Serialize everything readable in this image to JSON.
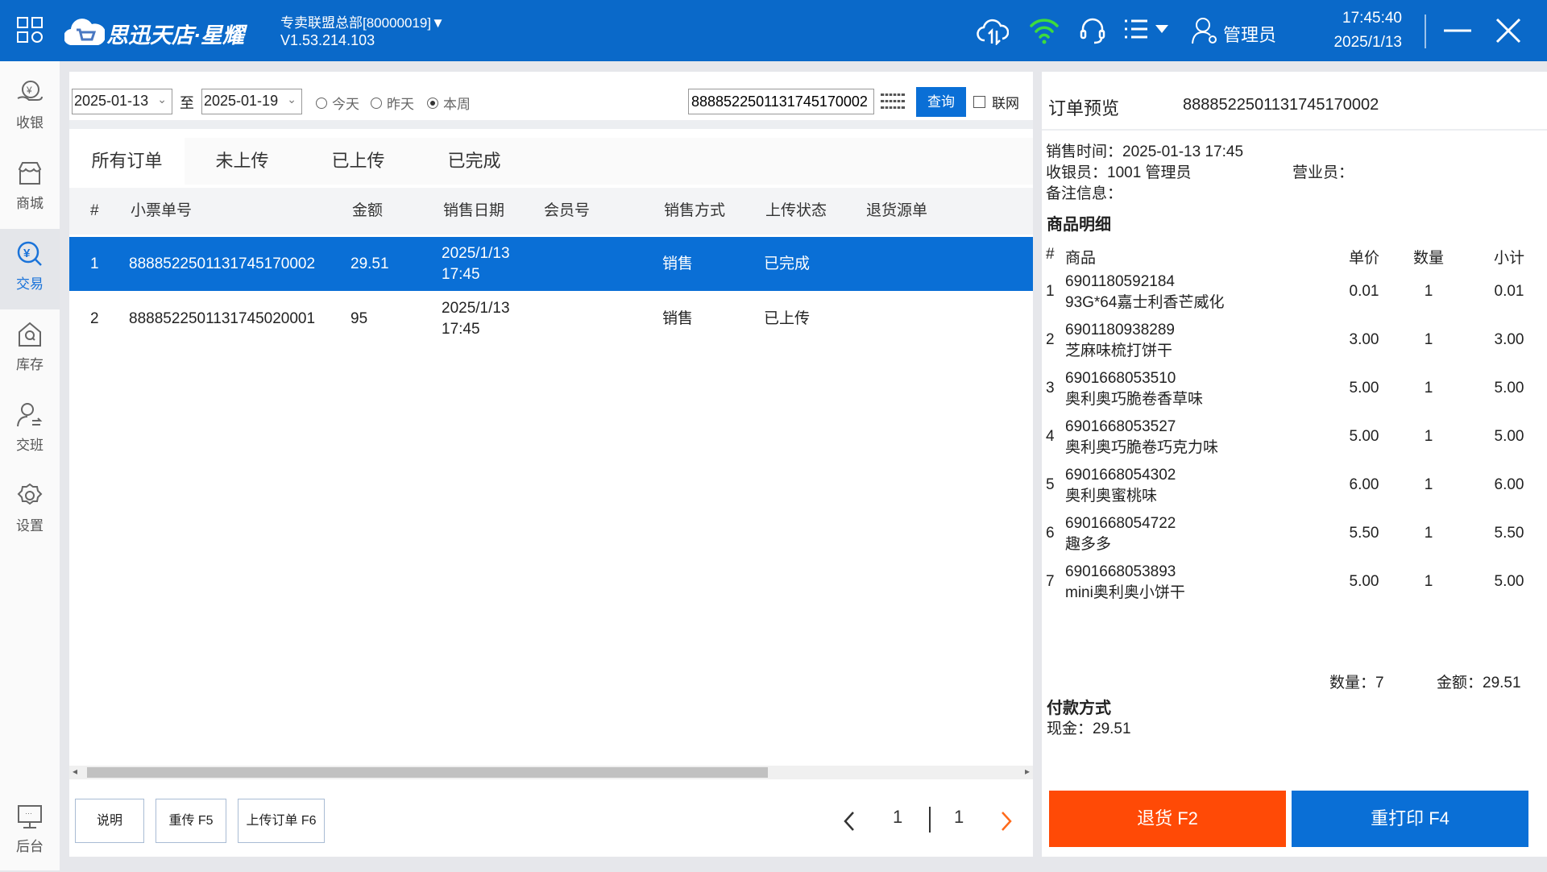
{
  "header": {
    "brand": "思迅天店·星耀",
    "store": "专卖联盟总部[80000019]▼",
    "version": "V1.53.214.103",
    "user": "管理员",
    "time": "17:45:40",
    "date": "2025/1/13",
    "wifi_color": "#3ddc3d",
    "bg_color": "#0a69c9"
  },
  "sidebar": {
    "items": [
      {
        "label": "收银",
        "icon": "cashier-icon"
      },
      {
        "label": "商城",
        "icon": "shop-icon"
      },
      {
        "label": "交易",
        "icon": "transaction-icon",
        "active": true
      },
      {
        "label": "库存",
        "icon": "inventory-icon"
      },
      {
        "label": "交班",
        "icon": "shift-icon"
      },
      {
        "label": "设置",
        "icon": "settings-icon"
      }
    ],
    "bottom": {
      "label": "后台",
      "icon": "monitor-icon"
    }
  },
  "filter": {
    "start_date": "2025-01-13",
    "to": "至",
    "end_date": "2025-01-19",
    "radios": [
      "今天",
      "昨天",
      "本周"
    ],
    "selected_radio": "本周",
    "search_value": "8888522501131745170002",
    "query_label": "查询",
    "online_label": "联网",
    "online_checked": false
  },
  "tabs": [
    "所有订单",
    "未上传",
    "已上传",
    "已完成"
  ],
  "table": {
    "columns": [
      "#",
      "小票单号",
      "金额",
      "销售日期",
      "会员号",
      "销售方式",
      "上传状态",
      "退货源单"
    ],
    "rows": [
      {
        "no": "1",
        "ticket": "8888522501131745170002",
        "amount": "29.51",
        "date": "2025/1/13",
        "time": "17:45",
        "member": "",
        "method": "销售",
        "status": "已完成",
        "source": "",
        "selected": true
      },
      {
        "no": "2",
        "ticket": "8888522501131745020001",
        "amount": "95",
        "date": "2025/1/13",
        "time": "17:45",
        "member": "",
        "method": "销售",
        "status": "已上传",
        "source": "",
        "selected": false
      }
    ]
  },
  "footer": {
    "buttons": [
      "说明",
      "重传 F5",
      "上传订单 F6"
    ],
    "page_current": "1",
    "page_total": "1"
  },
  "preview": {
    "title": "订单预览",
    "order_no": "8888522501131745170002",
    "sale_time": "销售时间：2025-01-13 17:45",
    "cashier": "收银员：1001 管理员",
    "salesperson": "营业员：",
    "notes": "备注信息：",
    "detail_title": "商品明细",
    "columns": [
      "#",
      "商品",
      "单价",
      "数量",
      "小计"
    ],
    "items": [
      {
        "no": "1",
        "code": "6901180592184",
        "name": "93G*64嘉士利香芒威化",
        "price": "0.01",
        "qty": "1",
        "subtotal": "0.01"
      },
      {
        "no": "2",
        "code": "6901180938289",
        "name": "芝麻味梳打饼干",
        "price": "3.00",
        "qty": "1",
        "subtotal": "3.00"
      },
      {
        "no": "3",
        "code": "6901668053510",
        "name": "奥利奥巧脆卷香草味",
        "price": "5.00",
        "qty": "1",
        "subtotal": "5.00"
      },
      {
        "no": "4",
        "code": "6901668053527",
        "name": "奥利奥巧脆卷巧克力味",
        "price": "5.00",
        "qty": "1",
        "subtotal": "5.00"
      },
      {
        "no": "5",
        "code": "6901668054302",
        "name": "奥利奥蜜桃味",
        "price": "6.00",
        "qty": "1",
        "subtotal": "6.00"
      },
      {
        "no": "6",
        "code": "6901668054722",
        "name": "趣多多",
        "price": "5.50",
        "qty": "1",
        "subtotal": "5.50"
      },
      {
        "no": "7",
        "code": "6901668053893",
        "name": "mini奥利奥小饼干",
        "price": "5.00",
        "qty": "1",
        "subtotal": "5.00"
      }
    ],
    "total_qty": "数量：7",
    "total_amount": "金额：29.51",
    "payment_title": "付款方式",
    "payment": "现金：29.51",
    "return_label": "退货 F2",
    "reprint_label": "重打印 F4",
    "return_color": "#ff4a06",
    "reprint_color": "#0a6fd6"
  }
}
